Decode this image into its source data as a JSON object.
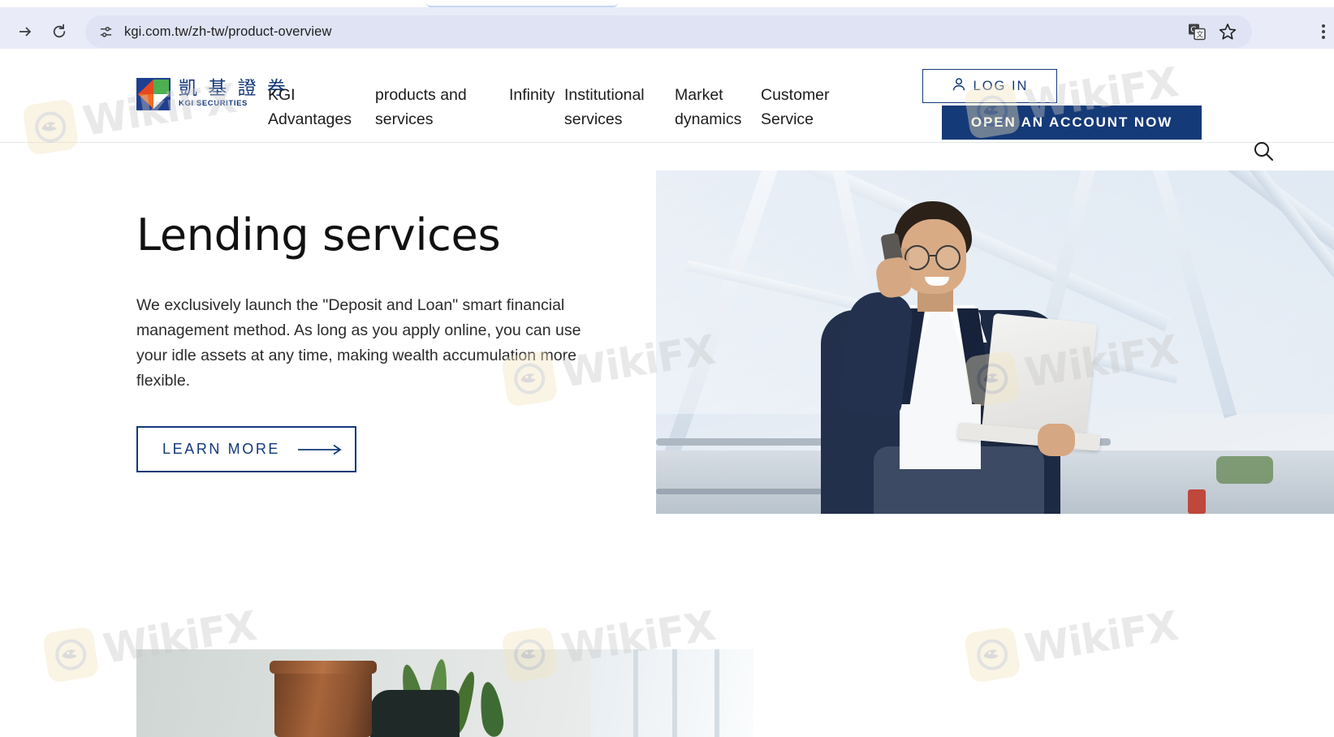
{
  "browser": {
    "url": "kgi.com.tw/zh-tw/product-overview",
    "forward_icon": "arrow-right-icon",
    "reload_icon": "reload-icon",
    "site_info_icon": "tune-icon",
    "translate_icon": "translate-icon",
    "bookmark_icon": "star-icon",
    "menu_icon": "kebab-menu-icon"
  },
  "site_header": {
    "brand": {
      "chinese_name": "凱 基 證 券",
      "english_name": "KGI SECURITIES",
      "logo_icon": "kgi-diamond-logo"
    },
    "nav_items": [
      {
        "label": "KGI Advantages"
      },
      {
        "label": "products and services"
      },
      {
        "label": "Infinity"
      },
      {
        "label": "Institutional services"
      },
      {
        "label": "Market dynamics"
      },
      {
        "label": "Customer Service"
      }
    ],
    "login": {
      "label": "LOG IN",
      "icon": "user-icon"
    },
    "open_account": {
      "label": "OPEN AN ACCOUNT NOW"
    },
    "search_icon": "search-icon",
    "accent_navy": "#153a78"
  },
  "hero": {
    "title": "Lending services",
    "description": "We exclusively launch the \"Deposit and Loan\" smart financial management method. As long as you apply online, you can use your idle assets at any time, making wealth accumulation more flexible.",
    "cta": {
      "label": "LEARN MORE",
      "arrow_icon": "arrow-right-long-icon"
    },
    "image_alt": "businessman-on-phone-with-laptop"
  },
  "second_section": {
    "image_alt": "office-interior-with-plant"
  },
  "watermarks": {
    "text": "WikiFX",
    "badge_icon": "wikifx-eagle-icon"
  }
}
